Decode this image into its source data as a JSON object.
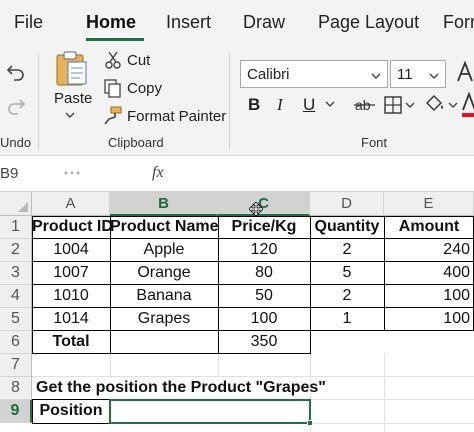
{
  "tabs": [
    {
      "label": "File"
    },
    {
      "label": "Home"
    },
    {
      "label": "Insert"
    },
    {
      "label": "Draw"
    },
    {
      "label": "Page Layout"
    },
    {
      "label": "Form"
    }
  ],
  "ribbon": {
    "undo_group_label": "Undo",
    "clipboard": {
      "paste_label": "Paste",
      "cut_label": "Cut",
      "copy_label": "Copy",
      "format_painter_label": "Format Painter",
      "group_label": "Clipboard"
    },
    "font": {
      "font_name": "Calibri",
      "font_size": "11",
      "bold": "B",
      "italic": "I",
      "underline": "U",
      "group_label": "Font"
    }
  },
  "formula_bar": {
    "name_box": "B9",
    "fx": "fx"
  },
  "columns": [
    "A",
    "B",
    "C",
    "D",
    "E"
  ],
  "rows": [
    "1",
    "2",
    "3",
    "4",
    "5",
    "6",
    "7",
    "8",
    "9"
  ],
  "table": {
    "headers": [
      "Product ID",
      "Product Name",
      "Price/Kg",
      "Quantity",
      "Amount"
    ],
    "rows": [
      [
        "1004",
        "Apple",
        "120",
        "2",
        "240"
      ],
      [
        "1007",
        "Orange",
        "80",
        "5",
        "400"
      ],
      [
        "1010",
        "Banana",
        "50",
        "2",
        "100"
      ],
      [
        "1014",
        "Grapes",
        "100",
        "1",
        "100"
      ]
    ],
    "total_label": "Total",
    "total_value": "350"
  },
  "question": "Get the position the Product \"Grapes\"",
  "position_label": "Position",
  "colors": {
    "accent": "#1e7145",
    "font_color_bar": "#e81123"
  }
}
